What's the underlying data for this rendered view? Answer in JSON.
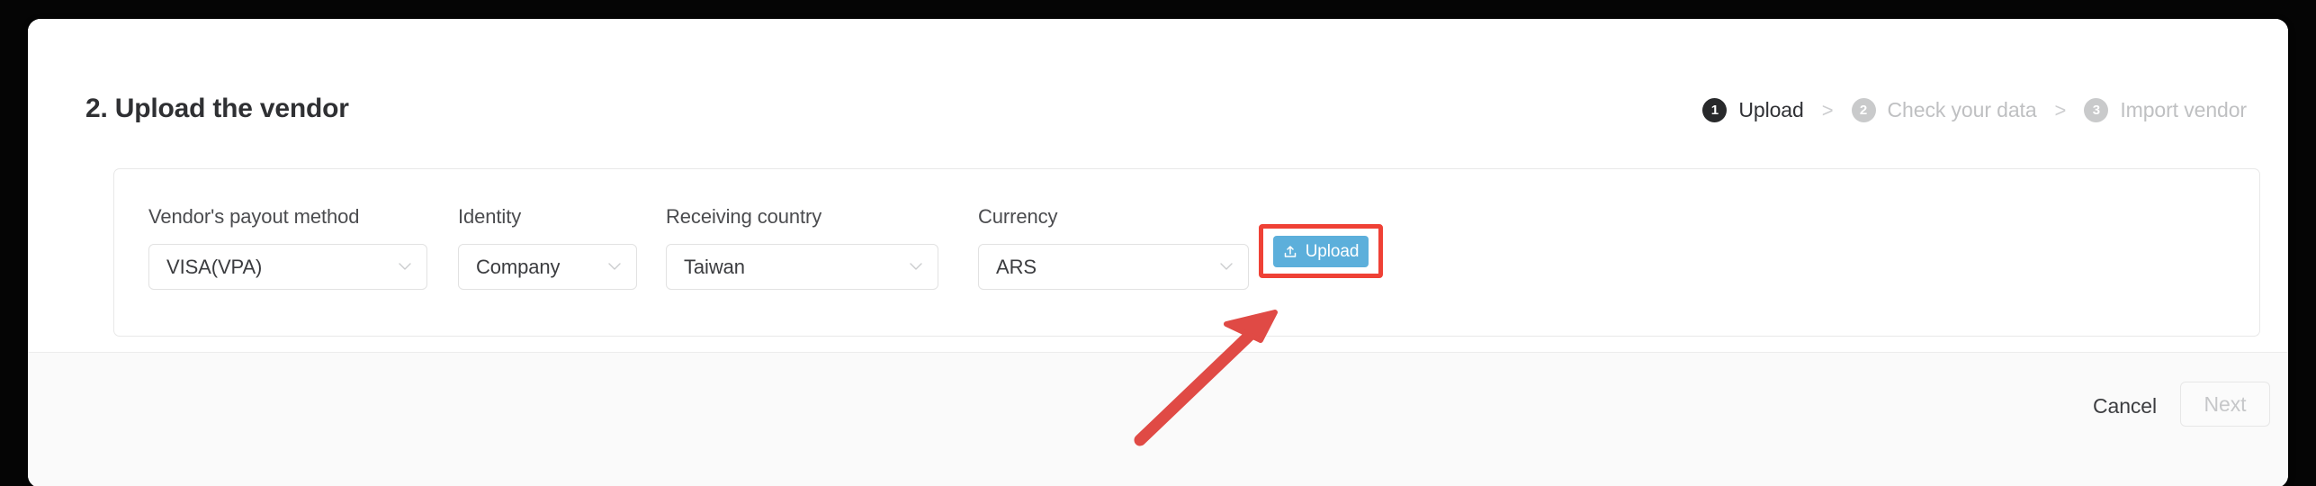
{
  "modal": {
    "title": "2. Upload the vendor",
    "stepper": [
      {
        "number": "1",
        "label": "Upload",
        "state": "active"
      },
      {
        "number": "2",
        "label": "Check your data",
        "state": "idle"
      },
      {
        "number": "3",
        "label": "Import vendor",
        "state": "idle"
      }
    ],
    "separator": ">",
    "form": {
      "fields": [
        {
          "label": "Vendor's payout method",
          "value": "VISA(VPA)"
        },
        {
          "label": "Identity",
          "value": "Company"
        },
        {
          "label": "Receiving country",
          "value": "Taiwan"
        },
        {
          "label": "Currency",
          "value": "ARS"
        }
      ],
      "upload_label": "Upload"
    },
    "footer": {
      "cancel_label": "Cancel",
      "next_label": "Next"
    }
  },
  "colors": {
    "upload_button": "#5cafdb",
    "highlight_box": "#ef4136",
    "annotation_arrow": "#e04a45",
    "step_active": "#28292b",
    "step_idle": "#c9cacb"
  }
}
